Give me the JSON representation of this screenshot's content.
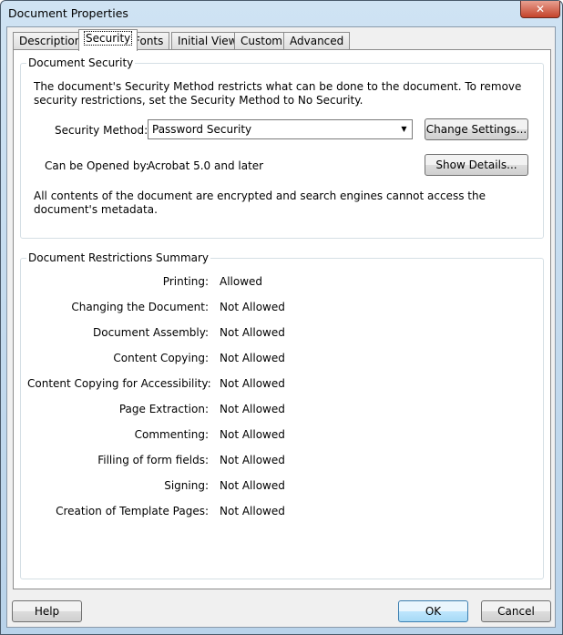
{
  "window": {
    "title": "Document Properties",
    "close": "✕"
  },
  "tabs": [
    "Description",
    "Security",
    "Fonts",
    "Initial View",
    "Custom",
    "Advanced"
  ],
  "security": {
    "group_label": "Document Security",
    "intro": "The document's Security Method restricts what can be done to the document. To remove security restrictions, set the Security Method to No Security.",
    "method_label": "Security Method:",
    "method_value": "Password Security",
    "change_settings": "Change Settings...",
    "opened_label": "Can be Opened by:",
    "opened_value": "Acrobat 5.0 and later",
    "show_details": "Show Details...",
    "note": "All contents of the document are encrypted and search engines cannot access the document's metadata."
  },
  "restrictions": {
    "group_label": "Document Restrictions Summary",
    "rows": [
      {
        "label": "Printing:",
        "value": "Allowed"
      },
      {
        "label": "Changing the Document:",
        "value": "Not Allowed"
      },
      {
        "label": "Document Assembly:",
        "value": "Not Allowed"
      },
      {
        "label": "Content Copying:",
        "value": "Not Allowed"
      },
      {
        "label": "Content Copying for Accessibility:",
        "value": "Not Allowed"
      },
      {
        "label": "Page Extraction:",
        "value": "Not Allowed"
      },
      {
        "label": "Commenting:",
        "value": "Not Allowed"
      },
      {
        "label": "Filling of form fields:",
        "value": "Not Allowed"
      },
      {
        "label": "Signing:",
        "value": "Not Allowed"
      },
      {
        "label": "Creation of Template Pages:",
        "value": "Not Allowed"
      }
    ]
  },
  "buttons": {
    "help": "Help",
    "ok": "OK",
    "cancel": "Cancel"
  }
}
